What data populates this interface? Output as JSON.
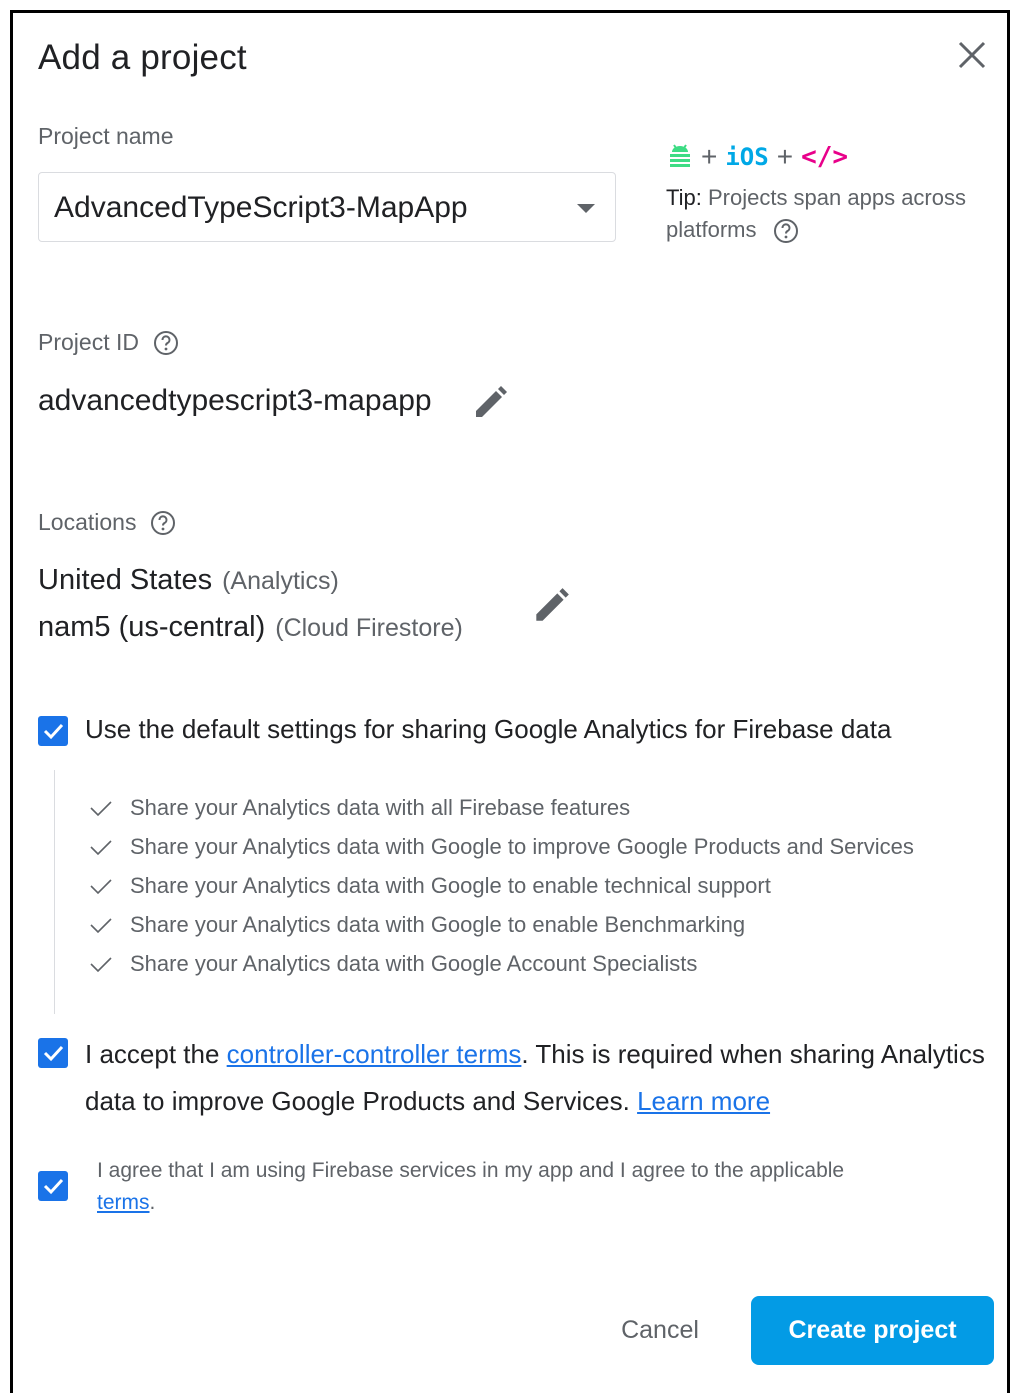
{
  "dialog": {
    "title": "Add a project",
    "project_name": {
      "label": "Project name",
      "value": "AdvancedTypeScript3-MapApp"
    },
    "tip": {
      "platforms": [
        "android-icon",
        "ios-icon",
        "web-code-icon"
      ],
      "ios_text": "iOS",
      "web_text": "</>",
      "plus": "+",
      "bold": "Tip:",
      "text": " Projects span apps across platforms"
    },
    "project_id": {
      "label": "Project ID",
      "value": "advancedtypescript3-mapapp"
    },
    "locations": {
      "label": "Locations",
      "rows": [
        {
          "value": "United States",
          "sub": "(Analytics)"
        },
        {
          "value": "nam5 (us-central)",
          "sub": "(Cloud Firestore)"
        }
      ]
    },
    "analytics_default": {
      "checked": true,
      "label": "Use the default settings for sharing Google Analytics for Firebase data",
      "items": [
        "Share your Analytics data with all Firebase features",
        "Share your Analytics data with Google to improve Google Products and Services",
        "Share your Analytics data with Google to enable technical support",
        "Share your Analytics data with Google to enable Benchmarking",
        "Share your Analytics data with Google Account Specialists"
      ]
    },
    "accept_terms": {
      "checked": true,
      "before": "I accept the ",
      "link": "controller-controller terms",
      "after": ". This is required when sharing Analytics data to improve Google Products and Services. ",
      "learn_more": "Learn more"
    },
    "agree_terms": {
      "checked": true,
      "before": "I agree that I am using Firebase services in my app and I agree to the applicable ",
      "link": "terms",
      "after": "."
    },
    "buttons": {
      "cancel": "Cancel",
      "create": "Create project"
    }
  },
  "colors": {
    "accent": "#1a73e8",
    "primary_button": "#039be5",
    "android": "#3ddc84",
    "ios": "#00a8e6",
    "web": "#e8008a"
  }
}
